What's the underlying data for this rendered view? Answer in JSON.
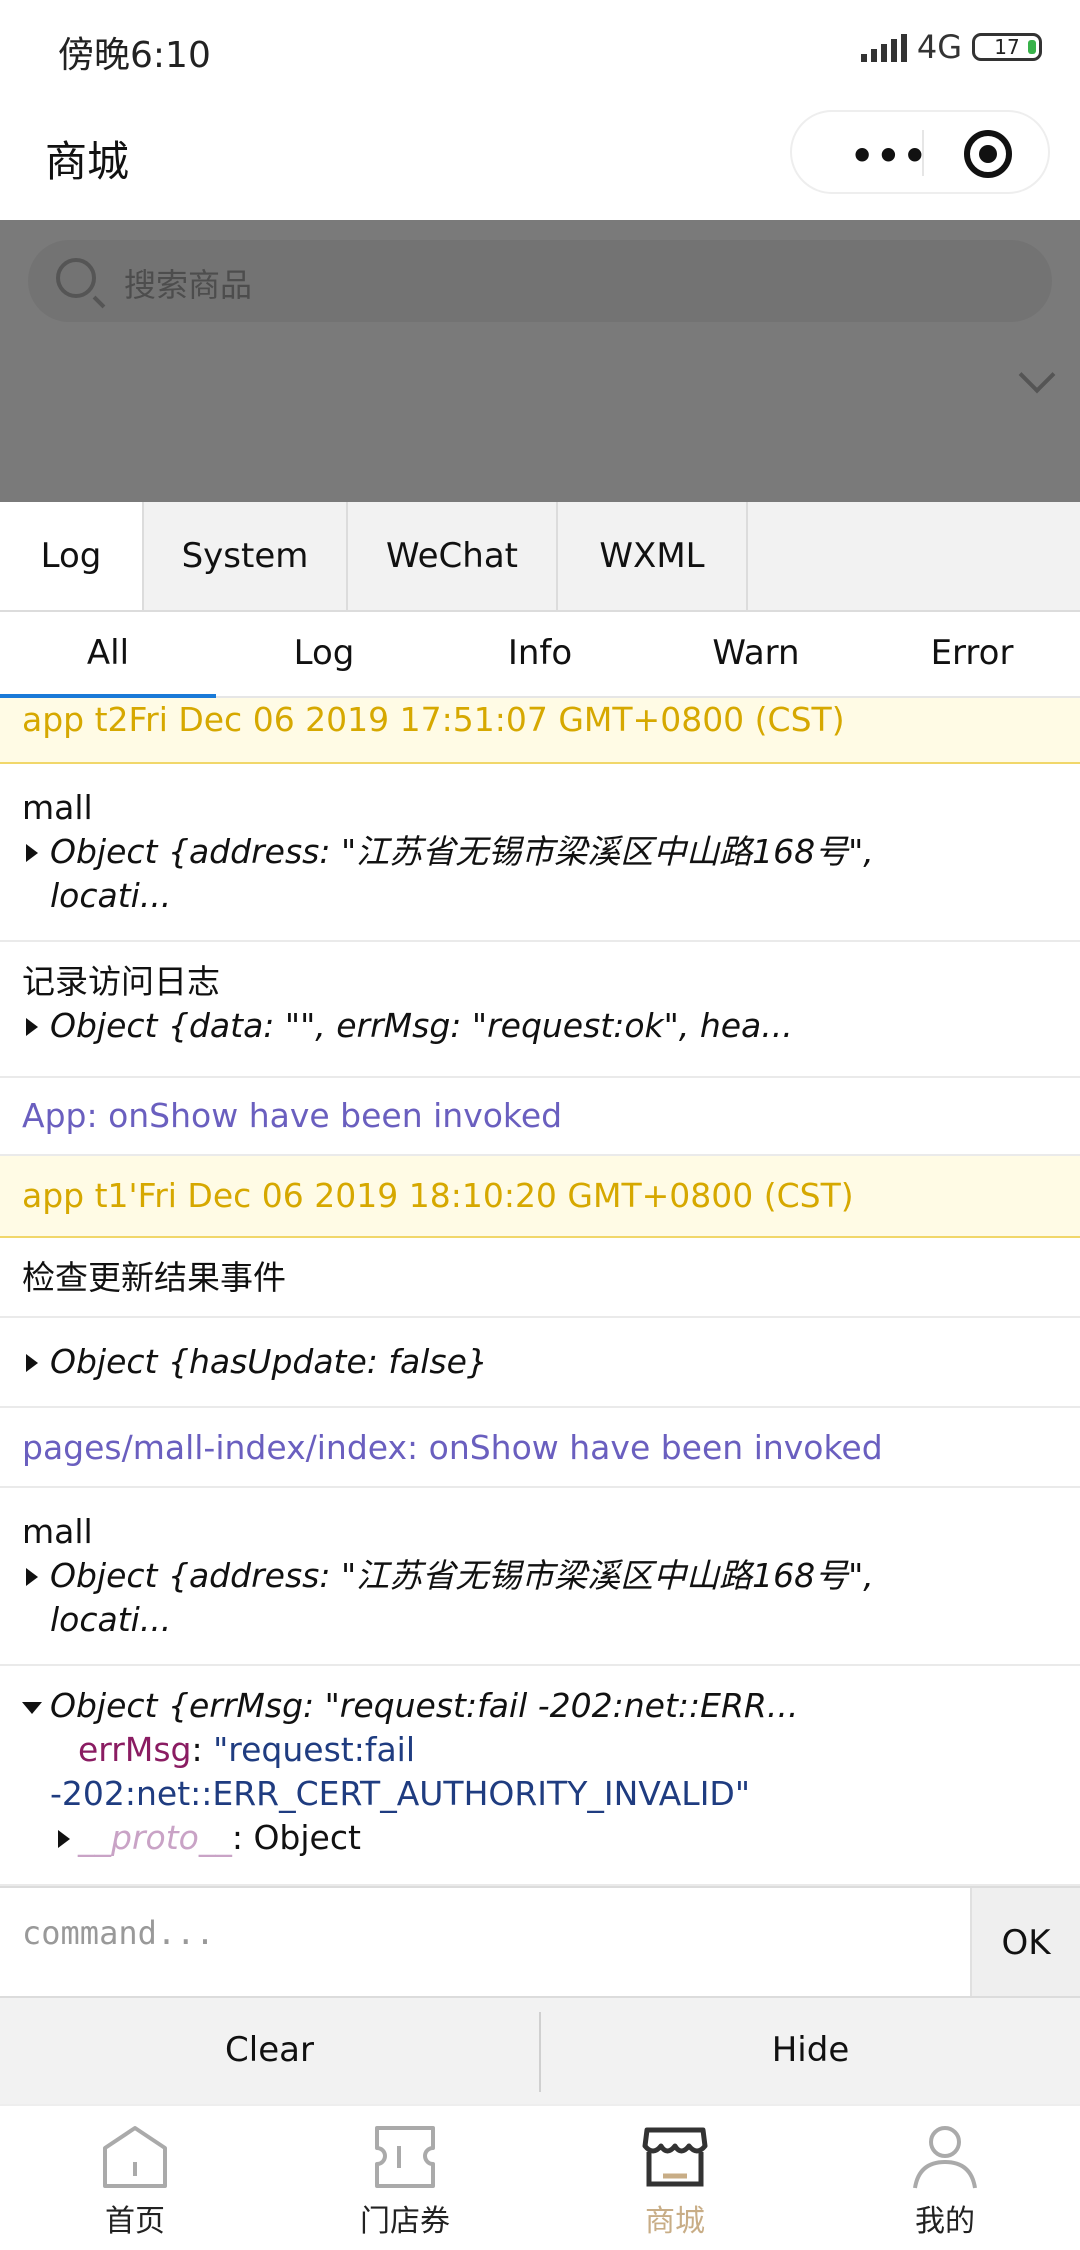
{
  "status": {
    "time": "傍晚6:10",
    "network": "4G",
    "battery": "17"
  },
  "navbar": {
    "title": "商城"
  },
  "search": {
    "placeholder": "搜索商品"
  },
  "console": {
    "tabs": [
      "Log",
      "System",
      "WeChat",
      "WXML"
    ],
    "subtabs": [
      "All",
      "Log",
      "Info",
      "Warn",
      "Error"
    ],
    "logs": {
      "r1": "app t2Fri Dec 06 2019 17:51:07 GMT+0800 (CST)",
      "r2_label": "mall",
      "r2_obj": "Object {address: \"江苏省无锡市梁溪区中山路168号\",",
      "r2_cont": "locati...",
      "r3_label": "记录访问日志",
      "r3_obj": "Object {data: \"\", errMsg: \"request:ok\", hea...",
      "r4": "App: onShow have been invoked",
      "r5": "app t1'Fri Dec 06 2019 18:10:20 GMT+0800 (CST)",
      "r6": "检查更新结果事件",
      "r7_obj": "Object {hasUpdate: false}",
      "r8": "pages/mall-index/index: onShow have been invoked",
      "r9_label": "mall",
      "r9_obj": "Object {address: \"江苏省无锡市梁溪区中山路168号\",",
      "r9_cont": "locati...",
      "r10_obj": "Object {errMsg: \"request:fail -202:net::ERR...",
      "r10_key": "errMsg",
      "r10_val1": "\"request:fail",
      "r10_val2": "-202:net::ERR_CERT_AUTHORITY_INVALID\"",
      "r10_proto": "__proto__",
      "r10_proto_val": ": Object"
    },
    "command": {
      "placeholder": "command...",
      "ok": "OK"
    },
    "footer": {
      "clear": "Clear",
      "hide": "Hide"
    }
  },
  "tabbar": {
    "items": [
      "首页",
      "门店券",
      "商城",
      "我的"
    ],
    "active": "商城",
    "active_color": "#c8ad86"
  }
}
